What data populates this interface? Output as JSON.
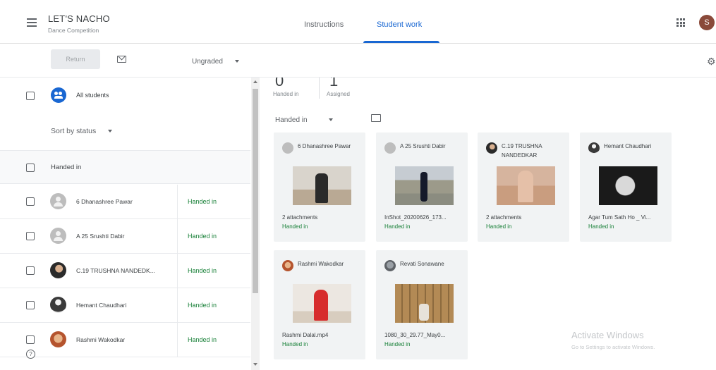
{
  "header": {
    "class_title": "LET'S NACHO",
    "class_subtitle": "Dance Competition",
    "tabs": [
      {
        "label": "Instructions",
        "active": false
      },
      {
        "label": "Student work",
        "active": true
      }
    ],
    "user_initial": "S",
    "accent_color": "#1967d2"
  },
  "toolbar": {
    "return_label": "Return",
    "grade_filter": "Ungraded"
  },
  "left": {
    "all_students_label": "All students",
    "sort_label": "Sort by status",
    "group_label": "Handed in",
    "students": [
      {
        "name": "6 Dhanashree Pawar",
        "status": "Handed in",
        "avatar": "generic"
      },
      {
        "name": "A 25 Srushti Dabir",
        "status": "Handed in",
        "avatar": "generic"
      },
      {
        "name": "C.19 TRUSHNA NANDEDK...",
        "status": "Handed in",
        "avatar": "photo"
      },
      {
        "name": "Hemant Chaudhari",
        "status": "Handed in",
        "avatar": "photo"
      },
      {
        "name": "Rashmi Wakodkar",
        "status": "Handed in",
        "avatar": "photo"
      }
    ],
    "help_glyph": "?"
  },
  "right": {
    "stats": [
      {
        "value": "0",
        "label": "Handed in"
      },
      {
        "value": "1",
        "label": "Assigned"
      }
    ],
    "filter_label": "Handed in",
    "cards": [
      {
        "name": "6 Dhanashree Pawar",
        "file": "2 attachments",
        "status": "Handed in"
      },
      {
        "name": "A 25 Srushti Dabir",
        "file": "InShot_20200626_173...",
        "status": "Handed in"
      },
      {
        "name": "C.19 TRUSHNA NANDEDKAR",
        "file": "2 attachments",
        "status": "Handed in"
      },
      {
        "name": "Hemant Chaudhari",
        "file": "Agar Tum Sath Ho _ Vi...",
        "status": "Handed in"
      },
      {
        "name": "Rashmi Wakodkar",
        "file": "Rashmi Dalal.mp4",
        "status": "Handed in"
      },
      {
        "name": "Revati Sonawane",
        "file": "1080_30_29.77_May0...",
        "status": "Handed in"
      }
    ]
  },
  "watermark": {
    "line1": "Activate Windows",
    "line2": "Go to Settings to activate Windows."
  },
  "colors": {
    "status_green": "#188038",
    "card_bg": "#f1f3f4"
  }
}
